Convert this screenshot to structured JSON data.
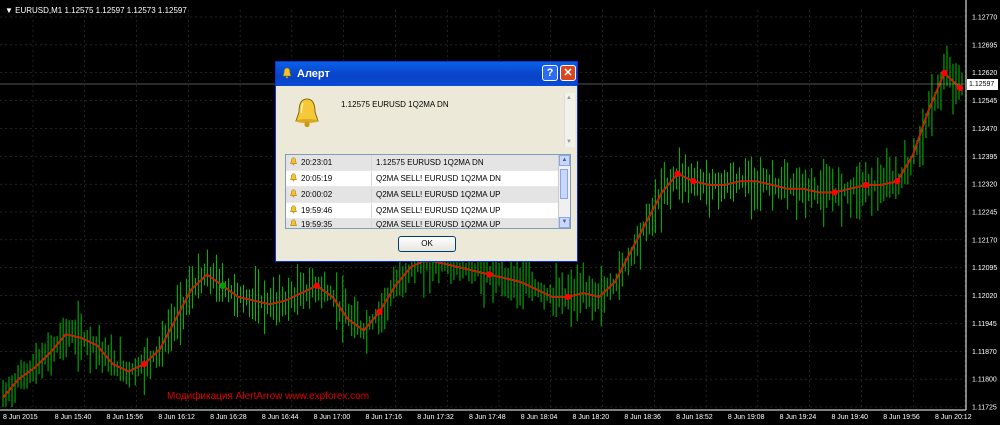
{
  "symbol_title": "EURUSD,M1  1.12575 1.12597 1.12573 1.12597",
  "watermark": "Модификация AlertArrow www.expforex.com",
  "current_price_tag": "1.12597",
  "price_axis": [
    "1.12770",
    "1.12695",
    "1.12620",
    "1.12545",
    "1.12470",
    "1.12395",
    "1.12320",
    "1.12245",
    "1.12170",
    "1.12095",
    "1.12020",
    "1.11945",
    "1.11870",
    "1.11800",
    "1.11725"
  ],
  "time_axis": [
    "8 Jun 2015",
    "8 Jun 15:40",
    "8 Jun 15:56",
    "8 Jun 16:12",
    "8 Jun 16:28",
    "8 Jun 16:44",
    "8 Jun 17:00",
    "8 Jun 17:16",
    "8 Jun 17:32",
    "8 Jun 17:48",
    "8 Jun 18:04",
    "8 Jun 18:20",
    "8 Jun 18:36",
    "8 Jun 18:52",
    "8 Jun 19:08",
    "8 Jun 19:24",
    "8 Jun 19:40",
    "8 Jun 19:56",
    "8 Jun 20:12"
  ],
  "colors": {
    "bars": "#00c000",
    "ma": "#ff0000",
    "arrow": "#ff0000",
    "arrow_up": "#00a000",
    "grid": "#3a4a3a"
  },
  "dialog": {
    "title": "Алерт",
    "message": "1.12575 EURUSD 1Q2MA DN",
    "ok_label": "OK",
    "history": [
      {
        "time": "20:23:01",
        "text": "1.12575 EURUSD 1Q2MA DN"
      },
      {
        "time": "20:05:19",
        "text": "Q2MA SELL! EURUSD 1Q2MA DN"
      },
      {
        "time": "20:00:02",
        "text": "Q2MA SELL! EURUSD 1Q2MA UP"
      },
      {
        "time": "19:59:46",
        "text": "Q2MA SELL! EURUSD 1Q2MA UP"
      },
      {
        "time": "19:59:35",
        "text": "Q2MA SELL! EURUSD 1Q2MA UP"
      }
    ]
  },
  "chart_data": {
    "type": "line",
    "series": [
      {
        "values": [
          1.1175,
          1.118,
          1.1183,
          1.1187,
          1.1192,
          1.1191,
          1.1189,
          1.1184,
          1.1182,
          1.1184,
          1.1188,
          1.1196,
          1.1204,
          1.1208,
          1.1205,
          1.1202,
          1.1201,
          1.12,
          1.1201,
          1.1203,
          1.1205,
          1.1202,
          1.1196,
          1.1193,
          1.1198,
          1.1205,
          1.121,
          1.1212,
          1.1211,
          1.121,
          1.1209,
          1.1208,
          1.1207,
          1.1206,
          1.1204,
          1.1202,
          1.1202,
          1.1203,
          1.1202,
          1.1206,
          1.1214,
          1.1222,
          1.123,
          1.1235,
          1.1233,
          1.1232,
          1.1232,
          1.1233,
          1.1233,
          1.1232,
          1.1231,
          1.1231,
          1.123,
          1.123,
          1.1231,
          1.1232,
          1.1232,
          1.1233,
          1.124,
          1.1252,
          1.1262,
          1.1258
        ]
      }
    ],
    "ylim": [
      1.11725,
      1.1277
    ]
  }
}
